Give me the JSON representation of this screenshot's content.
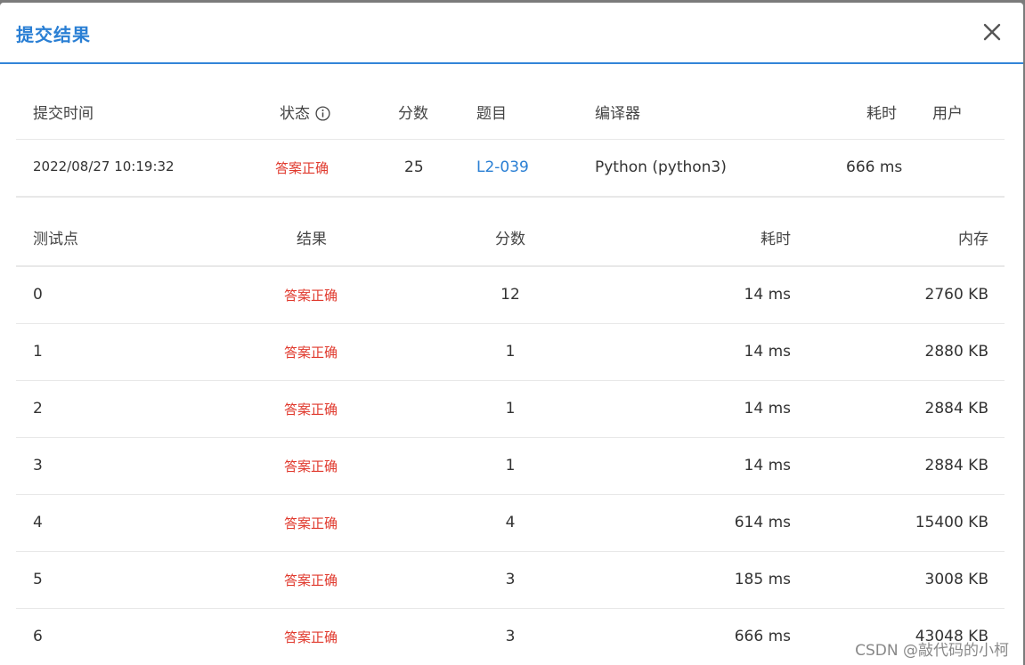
{
  "dialog": {
    "title": "提交结果",
    "close_icon": "close-icon"
  },
  "summary": {
    "headers": {
      "time": "提交时间",
      "status": "状态",
      "score": "分数",
      "problem": "题目",
      "compiler": "编译器",
      "elapsed": "耗时",
      "user": "用户"
    },
    "row": {
      "time": "2022/08/27 10:19:32",
      "status": "答案正确",
      "score": "25",
      "problem": "L2-039",
      "compiler": "Python (python3)",
      "elapsed": "666 ms",
      "user": ""
    }
  },
  "tests": {
    "headers": {
      "id": "测试点",
      "result": "结果",
      "score": "分数",
      "time": "耗时",
      "memory": "内存"
    },
    "rows": [
      {
        "id": "0",
        "result": "答案正确",
        "score": "12",
        "time": "14 ms",
        "memory": "2760 KB"
      },
      {
        "id": "1",
        "result": "答案正确",
        "score": "1",
        "time": "14 ms",
        "memory": "2880 KB"
      },
      {
        "id": "2",
        "result": "答案正确",
        "score": "1",
        "time": "14 ms",
        "memory": "2884 KB"
      },
      {
        "id": "3",
        "result": "答案正确",
        "score": "1",
        "time": "14 ms",
        "memory": "2884 KB"
      },
      {
        "id": "4",
        "result": "答案正确",
        "score": "4",
        "time": "614 ms",
        "memory": "15400 KB"
      },
      {
        "id": "5",
        "result": "答案正确",
        "score": "3",
        "time": "185 ms",
        "memory": "3008 KB"
      },
      {
        "id": "6",
        "result": "答案正确",
        "score": "3",
        "time": "666 ms",
        "memory": "43048 KB"
      }
    ]
  },
  "watermark": "CSDN @敲代码的小柯",
  "colors": {
    "accent": "#2a7fd4",
    "success_red": "#e0392d"
  }
}
